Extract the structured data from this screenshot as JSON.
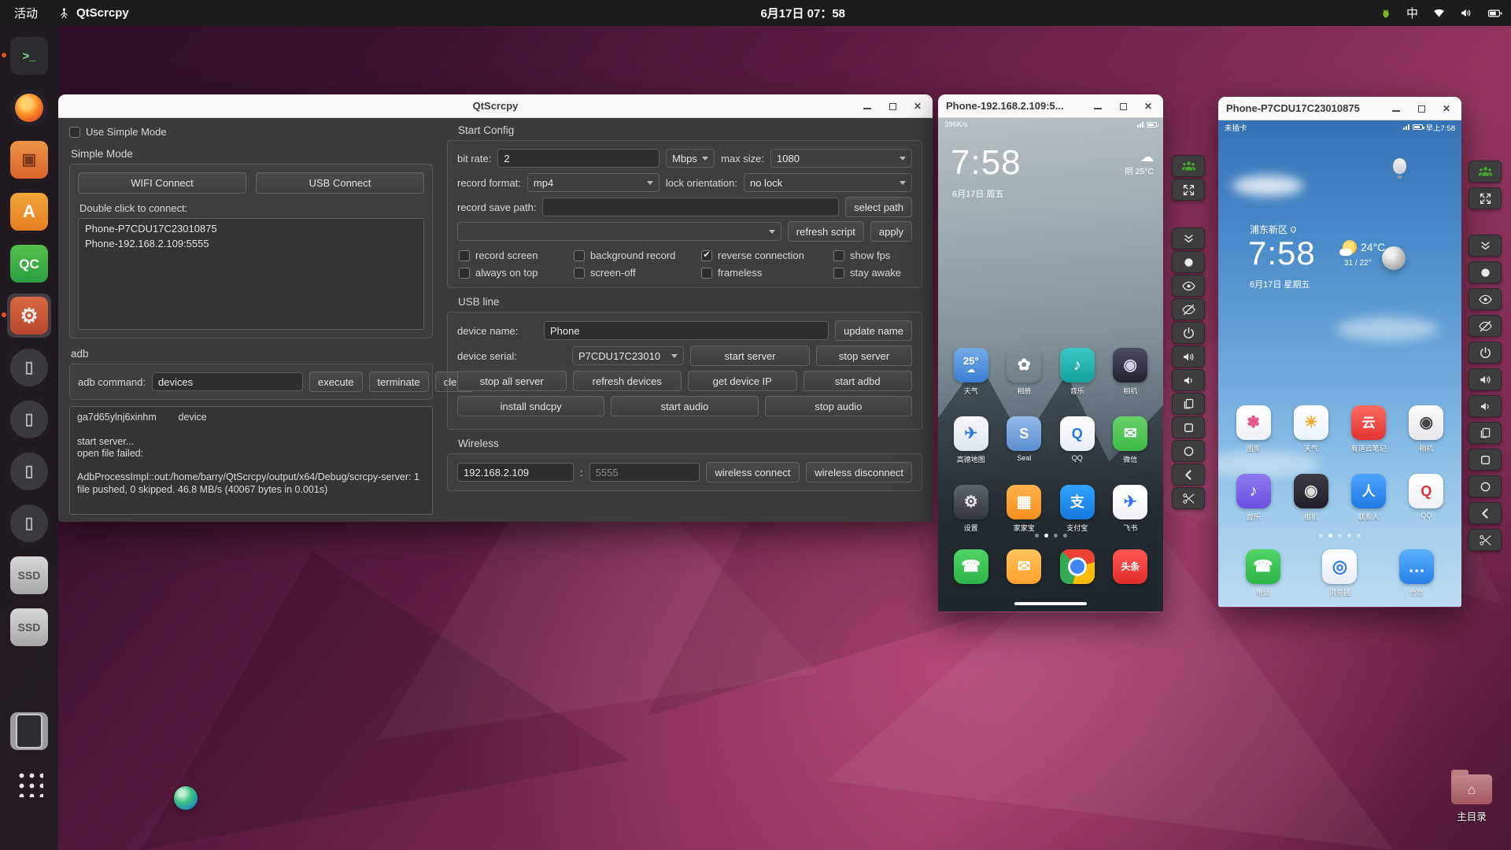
{
  "colors": {
    "accent_green": "#44a833",
    "topbar_bg": "#1c1c1c",
    "window_bg": "#3b3b3b",
    "titlebar_bg": "#faf9f8"
  },
  "topbar": {
    "activities": "活动",
    "app_name": "QtScrcpy",
    "clock": "6月17日 07：58",
    "input_method": "中",
    "tray_icons": [
      "app-indicator-green",
      "input-method",
      "wifi",
      "volume",
      "battery"
    ]
  },
  "dock": {
    "items": [
      {
        "name": "terminal",
        "glyph": ">_",
        "fg": "#7ee07e",
        "bg": "#2c2c30",
        "gsize": 15,
        "indicator": true
      },
      {
        "name": "firefox",
        "kind": "fox"
      },
      {
        "name": "files",
        "glyph": "▣",
        "fg": "#7c3a1d",
        "bg": "linear-gradient(180deg,#ef9546,#d9622c)",
        "gsize": 20
      },
      {
        "name": "ubuntu-software",
        "glyph": "A",
        "fg": "#fff",
        "bg": "linear-gradient(180deg,#f2a63c,#e67e22)",
        "gsize": 22
      },
      {
        "name": "qtcreator",
        "glyph": "QC",
        "fg": "#fff",
        "bg": "linear-gradient(180deg,#54c04a,#2a9d42)",
        "gsize": 17
      },
      {
        "name": "settings",
        "glyph": "⚙",
        "fg": "#e8e8e8",
        "bg": "linear-gradient(180deg,#d96a43,#b8452c)",
        "gsize": 26,
        "active": true,
        "indicator": true
      },
      {
        "name": "scrcpy-instance-1",
        "kind": "circle",
        "glyph": "▯",
        "fg": "#b5b5b5",
        "bg": "#3a3a3e",
        "gsize": 20
      },
      {
        "name": "scrcpy-instance-2",
        "kind": "circle",
        "glyph": "▯",
        "fg": "#b5b5b5",
        "bg": "#3a3a3e",
        "gsize": 20
      },
      {
        "name": "scrcpy-instance-3",
        "kind": "circle",
        "glyph": "▯",
        "fg": "#b5b5b5",
        "bg": "#3a3a3e",
        "gsize": 20
      },
      {
        "name": "scrcpy-instance-4",
        "kind": "circle",
        "glyph": "▯",
        "fg": "#b5b5b5",
        "bg": "#3a3a3e",
        "gsize": 20
      },
      {
        "name": "ssd-1",
        "glyph": "SSD",
        "fg": "#555",
        "bg": "linear-gradient(180deg,#d8d8d8,#a8a8a8)",
        "gsize": 14
      },
      {
        "name": "ssd-2",
        "glyph": "SSD",
        "fg": "#555",
        "bg": "linear-gradient(180deg,#d8d8d8,#a8a8a8)",
        "gsize": 14
      },
      {
        "name": "music-sphere",
        "kind": "sphere"
      },
      {
        "name": "phone-mirror",
        "kind": "phone-shape"
      },
      {
        "name": "show-applications",
        "kind": "dots"
      }
    ]
  },
  "main_window": {
    "title": "QtScrcpy",
    "use_simple_mode_label": "Use Simple Mode",
    "simple": {
      "section_label": "Simple Mode",
      "wifi_button": "WIFI Connect",
      "usb_button": "USB Connect",
      "double_click_label": "Double click to connect:",
      "devices": [
        "Phone-P7CDU17C23010875",
        "Phone-192.168.2.109:5555"
      ]
    },
    "adb": {
      "section_label": "adb",
      "command_label": "adb command:",
      "command_value": "devices",
      "execute": "execute",
      "terminate": "terminate",
      "clear": "clear",
      "log": "ga7d65ylnj6xinhm        device\n\nstart server...\nopen file failed:\n\nAdbProcessImpl::out:/home/barry/QtScrcpy/output/x64/Debug/scrcpy-server: 1 file pushed, 0 skipped. 46.8 MB/s (40067 bytes in 0.001s)"
    },
    "start_config": {
      "section_label": "Start Config",
      "bit_rate_label": "bit rate:",
      "bit_rate_value": "2",
      "bit_rate_unit": "Mbps",
      "max_size_label": "max size:",
      "max_size_value": "1080",
      "record_format_label": "record format:",
      "record_format_value": "mp4",
      "lock_orientation_label": "lock orientation:",
      "lock_orientation_value": "no lock",
      "record_save_path_label": "record save path:",
      "select_path": "select path",
      "refresh_script": "refresh script",
      "apply": "apply",
      "checkboxes": [
        {
          "label": "record screen",
          "checked": false
        },
        {
          "label": "background record",
          "checked": false
        },
        {
          "label": "reverse connection",
          "checked": true
        },
        {
          "label": "show fps",
          "checked": false
        },
        {
          "label": "always on top",
          "checked": false
        },
        {
          "label": "screen-off",
          "checked": false
        },
        {
          "label": "frameless",
          "checked": false
        },
        {
          "label": "stay awake",
          "checked": false
        }
      ]
    },
    "usb_line": {
      "section_label": "USB line",
      "device_name_label": "device name:",
      "device_name_value": "Phone",
      "update_name": "update name",
      "device_serial_label": "device serial:",
      "device_serial_value": "P7CDU17C23010",
      "start_server": "start server",
      "stop_server": "stop server",
      "stop_all_server": "stop all server",
      "refresh_devices": "refresh devices",
      "get_device_ip": "get device IP",
      "start_adbd": "start adbd",
      "install_sndcpy": "install sndcpy",
      "start_audio": "start audio",
      "stop_audio": "stop audio"
    },
    "wireless": {
      "section_label": "Wireless",
      "ip_value": "192.168.2.109",
      "separator": ":",
      "port_placeholder": "5555",
      "connect": "wireless connect",
      "disconnect": "wireless disconnect"
    }
  },
  "toolbar": {
    "gap_after": "full-screen",
    "buttons": [
      "group-control",
      "full-screen",
      "expand-notification",
      "screen-shot",
      "show-screen",
      "hide-screen",
      "power",
      "volume-up",
      "volume-down",
      "app-switch",
      "menu",
      "home",
      "back",
      "screen-clip"
    ]
  },
  "phone1": {
    "title": "Phone-192.168.2.109:5...",
    "status_left": "396K/s",
    "clock": "7:58",
    "date": "6月17日 周五",
    "weather_icon": "☁",
    "weather": "阴 25°C",
    "dots": {
      "count": 4,
      "active": 1
    },
    "app_rows": [
      [
        {
          "label": "天气",
          "glyph": "25°",
          "gs": 13,
          "glyph2": "☁",
          "bg": "linear-gradient(180deg,#74abe8,#3c7fd4)",
          "fg": "#fff"
        },
        {
          "label": "相册",
          "glyph": "✿",
          "bg": "linear-gradient(180deg,#d4c9f2,#aironb)",
          "fg": "#fff"
        },
        {
          "label": "音乐",
          "glyph": "♪",
          "bg": "linear-gradient(180deg,#3cc8c4,#14a09c)",
          "fg": "#fff"
        },
        {
          "label": "相机",
          "glyph": "◉",
          "bg": "linear-gradient(180deg,#4c4c60,#222230)",
          "fg": "#cfcfe8"
        }
      ],
      [
        {
          "label": "高德地图",
          "glyph": "✈",
          "bg": "linear-gradient(180deg,#f6f8fa,#dde6ee)",
          "fg": "#2f7bd9"
        },
        {
          "label": "Seal",
          "glyph": "S",
          "gs": 18,
          "bg": "linear-gradient(180deg,#93bbe9,#5d8fd1)",
          "fg": "#fff"
        },
        {
          "label": "QQ",
          "glyph": "Q",
          "gs": 18,
          "bg": "linear-gradient(180deg,#ffffff,#e8eef5)",
          "fg": "#1f77e0"
        },
        {
          "label": "微信",
          "glyph": "✉",
          "bg": "linear-gradient(180deg,#6ad06a,#3dbb49)",
          "fg": "#fff"
        }
      ],
      [
        {
          "label": "设置",
          "glyph": "⚙",
          "bg": "linear-gradient(180deg,#5d646b,#31363c)",
          "fg": "#e8e8e8"
        },
        {
          "label": "家家宝",
          "glyph": "▦",
          "bg": "linear-gradient(180deg,#ffb24d,#f78f1e)",
          "fg": "#fff"
        },
        {
          "label": "支付宝",
          "glyph": "支",
          "gs": 18,
          "bg": "linear-gradient(180deg,#30a5ff,#1677d9)",
          "fg": "#fff"
        },
        {
          "label": "飞书",
          "glyph": "✈",
          "bg": "linear-gradient(180deg,#ffffff,#eef2f7)",
          "fg": "#3370ff"
        }
      ]
    ],
    "dock": [
      {
        "name": "phone-app",
        "glyph": "☎",
        "bg": "linear-gradient(180deg,#52d466,#2bb548)",
        "fg": "#fff"
      },
      {
        "name": "messages-app",
        "glyph": "✉",
        "bg": "linear-gradient(180deg,#ffc65c,#ff9f2e)",
        "fg": "#fff"
      },
      {
        "name": "chrome-app",
        "bg": "chrome"
      },
      {
        "name": "toutiao-app",
        "glyph": "头条",
        "gs": 12,
        "bg": "linear-gradient(180deg,#ff5a52,#e02b2b)",
        "fg": "#fff"
      }
    ]
  },
  "phone2": {
    "title": "Phone-P7CDU17C23010875",
    "status_left": "未插卡",
    "status_right": "早上7:58",
    "location": "浦东新区",
    "clock": "7:58",
    "temp": "24°C",
    "temp_range": "31 / 22°",
    "date": "6月17日 星期五",
    "dots": {
      "count": 5,
      "active": 1
    },
    "app_rows": [
      [
        {
          "label": "图库",
          "glyph": "✽",
          "bg": "linear-gradient(180deg,#ffffff,#eef1f6)",
          "fg": "#e25a8b"
        },
        {
          "label": "天气",
          "glyph": "☀",
          "bg": "linear-gradient(180deg,#ffffff,#e9f2fb)",
          "fg": "#f5a623"
        },
        {
          "label": "有道云笔记",
          "glyph": "云",
          "gs": 17,
          "bg": "linear-gradient(180deg,#ff6b63,#e23333)",
          "fg": "#fff"
        },
        {
          "label": "相机",
          "glyph": "◉",
          "bg": "linear-gradient(180deg,#fdfdfd,#e7e7ec)",
          "fg": "#444"
        }
      ],
      [
        {
          "label": "音乐",
          "glyph": "♪",
          "bg": "linear-gradient(180deg,#8f7bf0,#6a4fe0)",
          "fg": "#fff"
        },
        {
          "label": "相机",
          "glyph": "◉",
          "bg": "linear-gradient(180deg,#3d3d47,#1e1e26)",
          "fg": "#ddd"
        },
        {
          "label": "联系人",
          "glyph": "人",
          "gs": 17,
          "bg": "linear-gradient(180deg,#4da3ff,#1f7ae0)",
          "fg": "#fff"
        },
        {
          "label": "QQ",
          "glyph": "Q",
          "gs": 18,
          "bg": "linear-gradient(180deg,#ffffff,#eef3f9)",
          "fg": "#d33"
        }
      ]
    ],
    "dock": [
      {
        "label": "电话",
        "glyph": "☎",
        "bg": "linear-gradient(180deg,#52d466,#2bb548)",
        "fg": "#fff"
      },
      {
        "label": "浏览器",
        "glyph": "◎",
        "gs": 22,
        "bg": "linear-gradient(180deg,#ffffff,#e8eef6)",
        "fg": "#2f7bd9"
      },
      {
        "label": "信息",
        "glyph": "…",
        "gs": 22,
        "bg": "linear-gradient(180deg,#5ab0ff,#2a7fe8)",
        "fg": "#fff"
      }
    ]
  },
  "desktop": {
    "home_folder_label": "主目录"
  }
}
